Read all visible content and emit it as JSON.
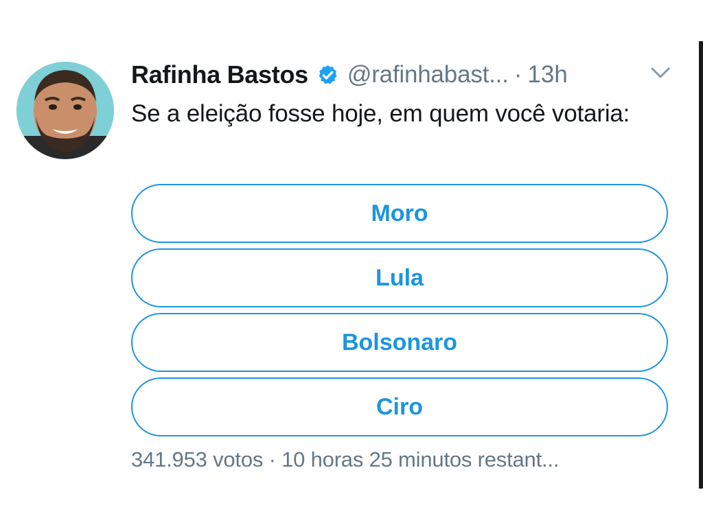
{
  "tweet": {
    "author": {
      "display_name": "Rafinha Bastos",
      "handle": "@rafinhabast...",
      "verified": true
    },
    "separator": "·",
    "time": "13h",
    "text": "Se a eleição fosse hoje, em quem você votaria:"
  },
  "poll": {
    "options": [
      {
        "label": "Moro"
      },
      {
        "label": "Lula"
      },
      {
        "label": "Bolsonaro"
      },
      {
        "label": "Ciro"
      }
    ],
    "footer": "341.953 votos · 10 horas 25 minutos restant..."
  },
  "icons": {
    "verified": "verified-badge-icon",
    "more": "chevron-down-icon"
  },
  "colors": {
    "accent": "#1b95e0",
    "verified": "#1da1f2",
    "text_primary": "#14171a",
    "text_secondary": "#657786"
  }
}
